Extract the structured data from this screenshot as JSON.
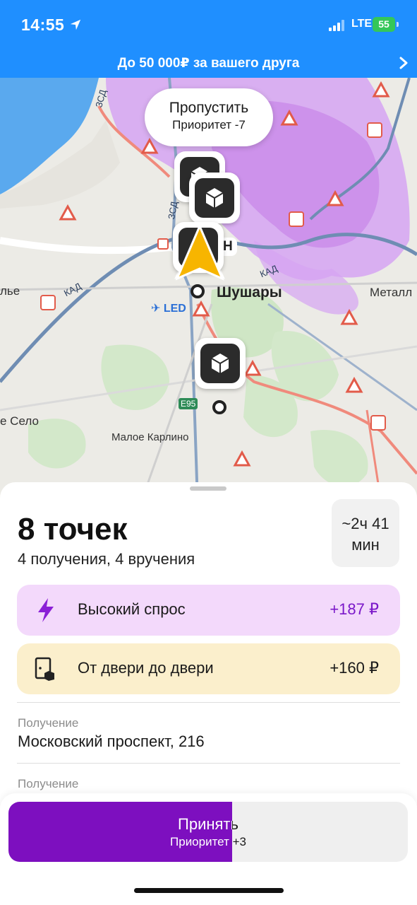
{
  "status_bar": {
    "time": "14:55",
    "network": "LTE",
    "battery": "55",
    "icons": [
      "location-arrow-icon",
      "signal-icon",
      "battery-icon"
    ]
  },
  "promo": {
    "text": "До 50 000₽ за вашего друга",
    "icon": "chevron-right-icon"
  },
  "map": {
    "skip_bubble": {
      "title": "Пропустить",
      "subtitle": "Приоритет -7"
    },
    "labels": {
      "shushary": "Шушары",
      "malkoe_karlino": "Малое Карлино",
      "selo": "е Село",
      "metall": "Металл",
      "lie": "лье",
      "airport": "LED",
      "e95": "E95",
      "kad": "КАД",
      "zsd": "ЗСД",
      "n": "Н"
    },
    "colors": {
      "demand_heat": "#c98df0",
      "route": "#f08a7c",
      "road_kad": "#5e7fa8",
      "water": "#3d9be9"
    }
  },
  "sheet": {
    "title": "8 точек",
    "subtitle": "4 получения, 4 вручения",
    "eta": {
      "line1": "~2ч 41",
      "line2": "мин"
    },
    "bonuses": [
      {
        "label": "Высокий спрос",
        "amount": "+187 ₽",
        "icon": "lightning-icon"
      },
      {
        "label": "От двери до двери",
        "amount": "+160 ₽",
        "icon": "door-box-icon"
      }
    ],
    "stops": [
      {
        "kind": "Получение",
        "address": "Московский проспект, 216"
      },
      {
        "kind": "Получение",
        "address": ""
      }
    ]
  },
  "accept_button": {
    "label": "Принять",
    "sub": "Приоритет +3",
    "progress_percent": 56,
    "fill_color": "#7d0fbf"
  }
}
